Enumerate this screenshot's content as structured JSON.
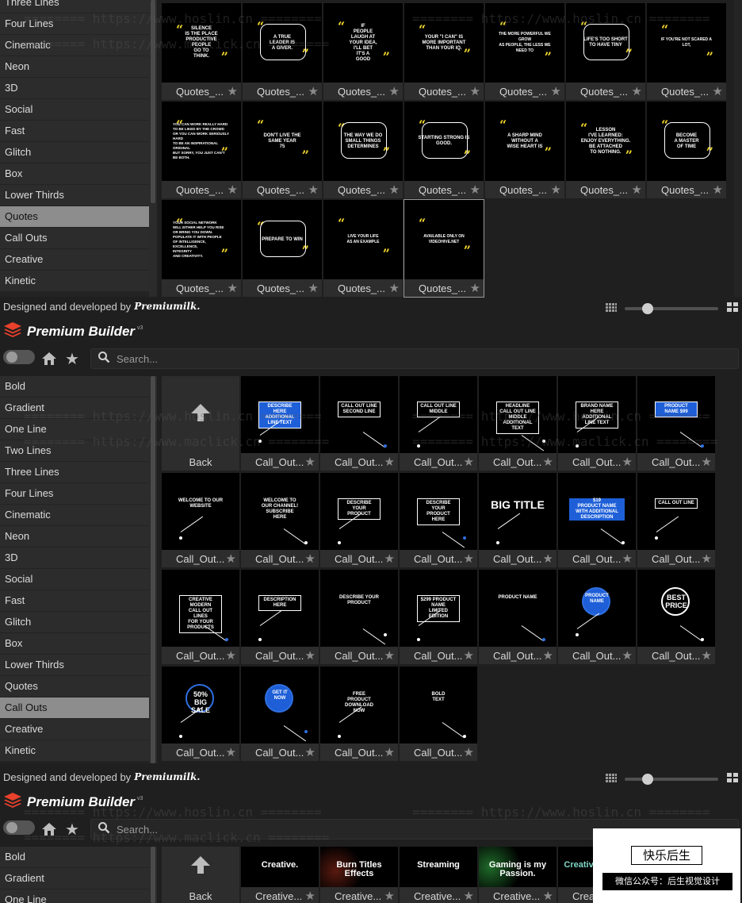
{
  "panel1": {
    "categories": [
      "Three Lines",
      "Four Lines",
      "Cinematic",
      "Neon",
      "3D",
      "Social",
      "Fast",
      "Glitch",
      "Box",
      "Lower Thirds",
      "Quotes",
      "Call Outs",
      "Creative",
      "Kinetic"
    ],
    "active_category": "Quotes",
    "caption": "Quotes_...",
    "thumbs": [
      "SILENCE\nIS THE PLACE\nPRODUCTIVE\nPEOPLE\nGO TO\nTHINK.",
      "A TRUE\nLEADER IS\nA GIVER.",
      "IF\nPEOPLE\nLAUGH AT\nYOUR IDEA,\nI'LL BET\nIT'S A\nGOOD",
      "YOUR \"I CAN\" IS\nMORE IMPORTANT\nTHAN YOUR IQ.",
      "THE MORE POWERFUL WE GROW\nAS PEOPLE, THE LESS WE NEED TO",
      "LIFE'S TOO SHORT\nTO HAVE TINY",
      "IF YOU'RE NOT SCARED A LOT,",
      "YOU CAN WORK REALLY HARD\nTO BE LIKED BY THE CROWD\nOR YOU CAN WORK SERIOUSLY HARD\nTO BE AN INSPIRATIONAL ORIGINAL\nBUT SORRY, YOU JUST CAN'T BE BOTH.",
      "DON'T LIVE THE\nSAME YEAR\n75",
      "THE WAY WE DO\nSMALL THINGS\nDETERMINES",
      "STARTING STRONG IS GOOD.",
      "A SHARP MIND\nWITHOUT A\nWISE HEART IS",
      "LESSON\nI'VE LEARNED:\nENJOY EVERYTHING.\nBE ATTACHED\nTO NOTHING.",
      "BECOME\nA MASTER\nOF TIME",
      "YOUR SOCIAL NETWORK\nWILL EITHER HELP YOU RISE\nOR BRING YOU DOWN.\nPOPULATE IT WITH PEOPLE\nOF INTELLIGENCE,\nEXCELLENCE,\nINTEGRITY\nAND CREATIVITY.",
      "PREPARE TO WIN",
      "LIVE YOUR LIFE\nAS AN EXAMPLE",
      "AVAILABLE ONLY ON VIDEOHIVE.NET"
    ]
  },
  "footer": {
    "text": "Designed and developed by",
    "logo": "Premiumilk."
  },
  "header": {
    "brand": "Premium Builder",
    "version": "v3"
  },
  "search": {
    "placeholder": "Search..."
  },
  "panel2": {
    "categories": [
      "Bold",
      "Gradient",
      "One Line",
      "Two Lines",
      "Three Lines",
      "Four Lines",
      "Cinematic",
      "Neon",
      "3D",
      "Social",
      "Fast",
      "Glitch",
      "Box",
      "Lower Thirds",
      "Quotes",
      "Call Outs",
      "Creative",
      "Kinetic"
    ],
    "active_category": "Call Outs",
    "back_label": "Back",
    "caption": "Call_Out...",
    "thumbs": [
      "DESCRIBE HERE\nADDITIONAL LINE TEXT",
      "CALL OUT LINE\nSECOND LINE",
      "CALL OUT LINE MIDDLE",
      "HEADLINE\nCALL OUT LINE MIDDLE\nADDITIONAL TEXT",
      "BRAND NAME HERE\nADDITIONAL LINE TEXT",
      "PRODUCT NAME $99",
      "WELCOME TO OUR WEBSITE",
      "WELCOME TO\nOUR CHANNEL!\nSUBSCRIBE\nHERE",
      "DESCRIBE YOUR PRODUCT",
      "DESCRIBE\nYOUR PRODUCT\nHERE",
      "BIG TITLE",
      "$19\nPRODUCT NAME\nWITH ADDITIONAL\nDESCRIPTION",
      "CALL OUT LINE",
      "CREATIVE MODERN\nCALL OUT LINES\nFOR YOUR PRODUCTS",
      "DESCRIPTION HERE",
      "DESCRIBE YOUR PRODUCT",
      "$299 PRODUCT NAME\nLIMITED EDITION",
      "PRODUCT NAME",
      "PRODUCT\nNAME",
      "BEST\nPRICE",
      "50%\nBIG\nSALE",
      "GET IT\nNOW",
      "FREE\nPRODUCT\nDOWNLOAD\nNOW",
      "BOLD\nTEXT"
    ]
  },
  "panel3": {
    "categories": [
      "Bold",
      "Gradient",
      "One Line"
    ],
    "back_label": "Back",
    "thumbs": [
      "Creative.",
      "Burn Titles Effects",
      "Streaming",
      "Gaming is my Passion.",
      "Creative Effects"
    ],
    "caption": "Creative..."
  },
  "badge": {
    "line1": "快乐后生",
    "line2": "微信公众号：后生视觉设计"
  },
  "watermarks": [
    "======== https://www.hoslin.cn ========",
    "======== https://www.maclick.cn ========"
  ]
}
